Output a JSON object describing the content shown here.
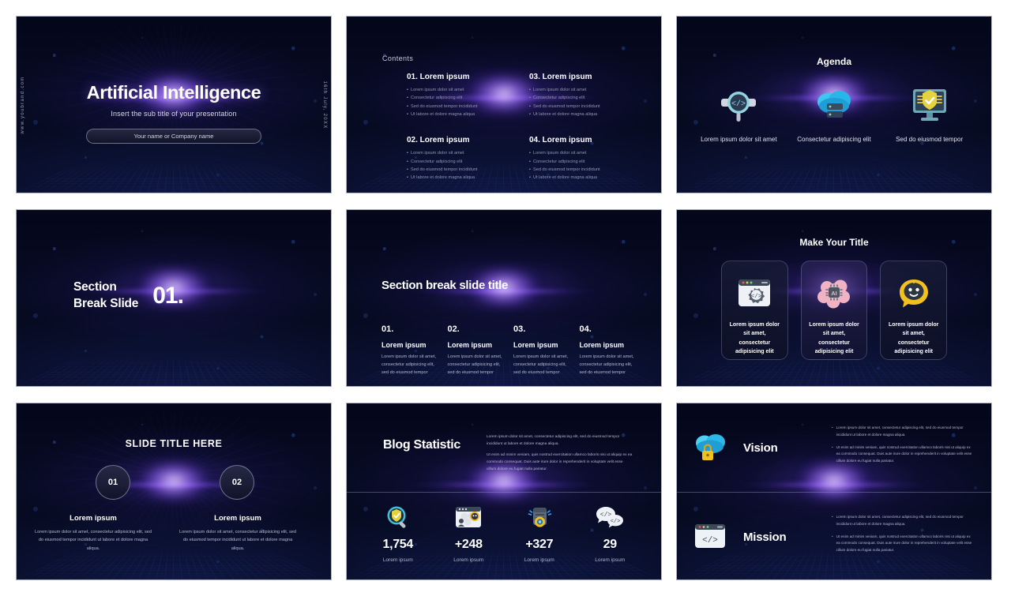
{
  "meta": {
    "theme_name": "Artificial Intelligence Presentation Template",
    "accent_purple": "#7B4BE0",
    "accent_blue": "#3C6EEB",
    "slide_bg": "#05081a"
  },
  "slides": [
    {
      "id": "title-slide",
      "title": "Artificial Intelligence",
      "subtitle": "Insert the sub title of your presentation",
      "button_label": "Your name or Company name",
      "side_left": "www.youbrand.com",
      "side_right": "16th July, 20XX"
    },
    {
      "id": "contents-slide",
      "kicker": "Contents",
      "items": [
        {
          "heading": "01. Lorem ipsum",
          "bullets": [
            "Lorem ipsum dolor sit amet",
            "Consectetur adipiscing elit",
            "Sed do eiusmod tempor incididunt",
            "Ut labore et dolore magna aliqua"
          ]
        },
        {
          "heading": "03. Lorem ipsum",
          "bullets": [
            "Lorem ipsum dolor sit amet",
            "Consectetur adipiscing elit",
            "Sed do eiusmod tempor incididunt",
            "Ut labore et dolore magna aliqua"
          ]
        },
        {
          "heading": "02. Lorem ipsum",
          "bullets": [
            "Lorem ipsum dolor sit amet",
            "Consectetur adipiscing elit",
            "Sed do eiusmod tempor incididunt",
            "Ut labore et dolore magna aliqua"
          ]
        },
        {
          "heading": "04. Lorem ipsum",
          "bullets": [
            "Lorem ipsum dolor sit amet",
            "Consectetur adipiscing elit",
            "Sed do eiusmod tempor incididunt",
            "Ut labore et dolore magna aliqua"
          ]
        }
      ]
    },
    {
      "id": "agenda-slide",
      "title": "Agenda",
      "columns": [
        {
          "icon": "magnifier-code-icon",
          "caption": "Lorem ipsum dolor sit amet"
        },
        {
          "icon": "cloud-server-icon",
          "caption": "Consectetur adipiscing elit"
        },
        {
          "icon": "monitor-shield-icon",
          "caption": "Sed do eiusmod tempor"
        }
      ]
    },
    {
      "id": "section-break-slide",
      "title_line1": "Section",
      "title_line2": "Break Slide",
      "number": "01."
    },
    {
      "id": "section-detail-slide",
      "title": "Section break slide title",
      "columns": [
        {
          "number": "01.",
          "heading": "Lorem ipsum",
          "body": "Lorem ipsum dolor sit amet, consectetur adipisicing elit, sed do eiusmod tempor"
        },
        {
          "number": "02.",
          "heading": "Lorem ipsum",
          "body": "Lorem ipsum dolor sit amet, consectetur adipisicing elit, sed do eiusmod tempor"
        },
        {
          "number": "03.",
          "heading": "Lorem ipsum",
          "body": "Lorem ipsum dolor sit amet, consectetur adipisicing elit, sed do eiusmod tempor"
        },
        {
          "number": "04.",
          "heading": "Lorem ipsum",
          "body": "Lorem ipsum dolor sit amet, consectetur adipisicing elit, sed do eiusmod tempor"
        }
      ]
    },
    {
      "id": "make-your-title-slide",
      "title": "Make Your Title",
      "cards": [
        {
          "icon": "browser-gear-code-icon",
          "text": "Lorem ipsum dolor sit amet, consectetur adipisicing elit"
        },
        {
          "icon": "ai-brain-chip-icon",
          "text": "Lorem ipsum dolor sit amet, consectetur adipisicing elit"
        },
        {
          "icon": "chatbot-bubble-icon",
          "text": "Lorem ipsum dolor sit amet, consectetur adipisicing elit"
        }
      ]
    },
    {
      "id": "slide-title-here-slide",
      "title": "SLIDE TITLE HERE",
      "items": [
        {
          "number": "01",
          "heading": "Lorem ipsum",
          "body": "Lorem ipsum dolor sit amet, consectetur adipisicing elit, sed do eiusmod tempor incididunt ut labore et dolore magna aliqua."
        },
        {
          "number": "02",
          "heading": "Lorem ipsum",
          "body": "Lorem ipsum dolor sit amet, consectetur adipisicing elit, sed do eiusmod tempor incididunt ut labore et dolore magna aliqua."
        }
      ]
    },
    {
      "id": "blog-statistic-slide",
      "title": "Blog Statistic",
      "paragraphs": [
        "Lorem ipsum dolor sit amet, consectetur adipiscing elit, sed do eiusmod tempor incididunt ut labore et dolore magna aliqua.",
        "Ut enim ad minim veniam, quis nostrud exercitation ullamco laboris nisi ut aliquip ex ea commodo consequat. Duis aute irure dolor in reprehenderit in voluptate velit esse cillum dolore eu fugiat nulla pariatur."
      ],
      "stats": [
        {
          "icon": "magnifier-shield-icon",
          "value": "1,754",
          "caption": "Lorem ipsum"
        },
        {
          "icon": "browser-user-bot-icon",
          "value": "+248",
          "caption": "Lorem ipsum"
        },
        {
          "icon": "server-badge-icon",
          "value": "+327",
          "caption": "Lorem ipsum"
        },
        {
          "icon": "code-chat-bubbles-icon",
          "value": "29",
          "caption": "Lorem ipsum"
        }
      ]
    },
    {
      "id": "vision-mission-slide",
      "sections": [
        {
          "icon": "cloud-lock-icon",
          "heading": "Vision",
          "bullets": [
            "Lorem ipsum dolor sit amet, consectetur adipiscing elit, sed do eiusmod tempor incididunt ut labore et dolore magna aliqua.",
            "Ut enim ad minim veniam, quis nostrud exercitation ullamco laboris nisi ut aliquip ex ea commodo consequat. Duis aute irure dolor in reprehenderit in voluptate velit esse cillum dolore eu fugiat nulla pariatur."
          ]
        },
        {
          "icon": "browser-code-icon",
          "heading": "Mission",
          "bullets": [
            "Lorem ipsum dolor sit amet, consectetur adipiscing elit, sed do eiusmod tempor incididunt ut labore et dolore magna aliqua.",
            "Ut enim ad minim veniam, quis nostrud exercitation ullamco laboris nisi ut aliquip ex ea commodo consequat. Duis aute irure dolor in reprehenderit in voluptate velit esse cillum dolore eu fugiat nulla pariatur."
          ]
        }
      ]
    }
  ]
}
